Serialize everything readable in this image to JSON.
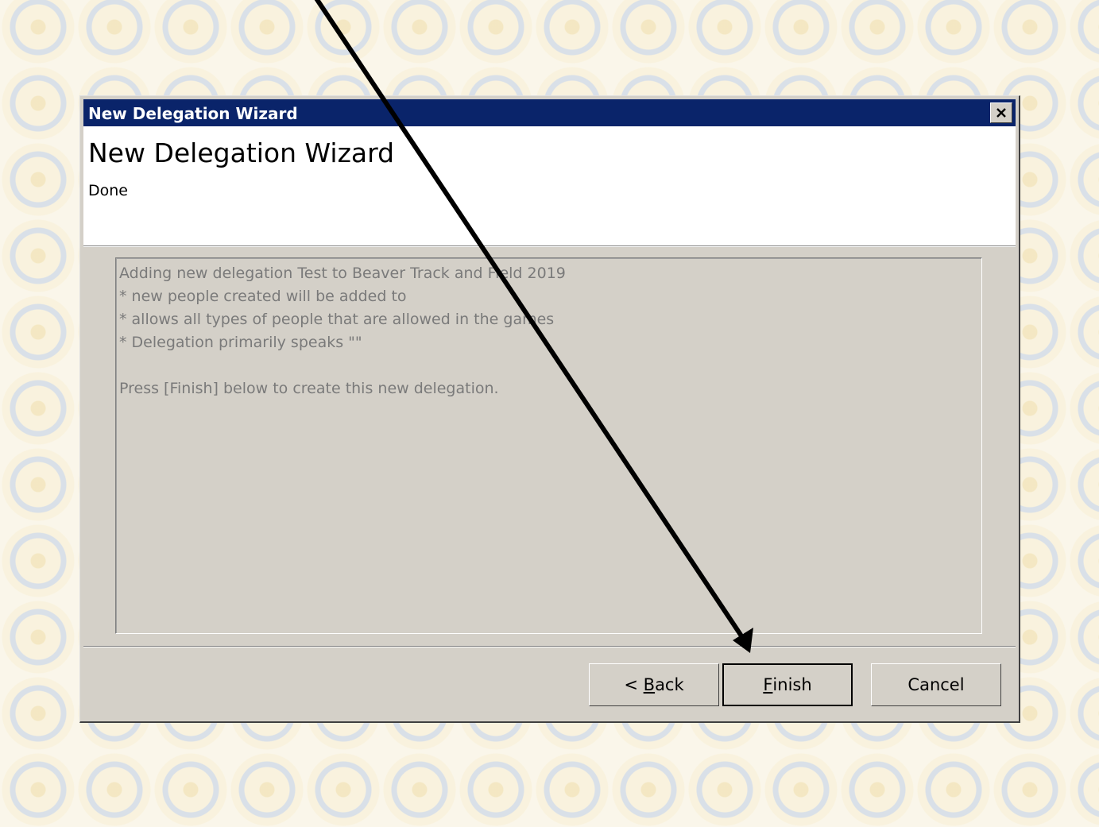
{
  "window": {
    "title": "New Delegation Wizard",
    "close_icon": "close-icon"
  },
  "header": {
    "heading": "New Delegation Wizard",
    "subheading": "Done"
  },
  "summary": {
    "lines": [
      "Adding new delegation Test to Beaver Track and Field 2019",
      "* new people created will be added to",
      "* allows all types of people that are allowed in the games",
      "* Delegation primarily speaks \"\"",
      "",
      "Press [Finish] below to create this new delegation."
    ]
  },
  "buttons": {
    "back": {
      "prefix": "< ",
      "accel": "B",
      "rest": "ack"
    },
    "finish": {
      "prefix": "",
      "accel": "F",
      "rest": "inish"
    },
    "cancel": {
      "label": "Cancel"
    }
  },
  "annotation": {
    "arrow_icon": "pointer-arrow-icon",
    "color": "#000000"
  },
  "colors": {
    "titlebar": "#0a246a",
    "dialog_face": "#d4d0c8",
    "disabled_text": "#7a7a7a"
  }
}
